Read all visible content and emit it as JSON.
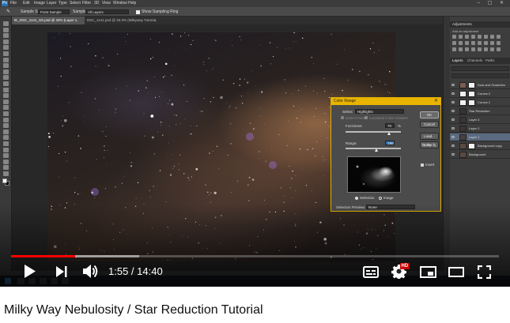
{
  "photoshop": {
    "logo": "Ps",
    "menu": [
      "File",
      "Edit",
      "Image",
      "Layer",
      "Type",
      "Select",
      "Filter",
      "3D",
      "View",
      "Window",
      "Help"
    ],
    "options": {
      "sample_size_label": "Sample Size:",
      "sample_size_value": "Point Sample",
      "sample_label": "Sample:",
      "sample_value": "All Layers",
      "show_ring_label": "Show Sampling Ring"
    },
    "tabs": [
      "IE_DSC_1141_SS.psd @ 33% (Layer 1, RGB/8) *",
      "DSC_1141.psd @ 33.3% (Milkyway Tutorial, RGB/8) *"
    ],
    "color_range": {
      "title": "Color Range",
      "select_label": "Select:",
      "select_value": "Highlights",
      "detect_faces": "Detect Faces",
      "localized_clusters": "Localized Color Clusters",
      "fuzziness_label": "Fuzziness:",
      "fuzziness_value": "70",
      "fuzziness_unit": "%",
      "range_label": "Range:",
      "range_value": "190",
      "view_selection": "Selection",
      "view_image": "Image",
      "preview_label": "Selection Preview:",
      "preview_value": "None",
      "buttons": [
        "OK",
        "Cancel",
        "Load...",
        "Save..."
      ],
      "invert_label": "Invert"
    },
    "adjustments": {
      "title": "Adjustments",
      "subtitle": "Add an adjustment"
    },
    "layers_tabs": [
      "Layers",
      "Channels",
      "Paths"
    ],
    "layers": [
      {
        "name": "Dust and Scratches",
        "mask": true,
        "selected": false,
        "thumb": "#7a5d50"
      },
      {
        "name": "Curves 2",
        "mask": true,
        "selected": false,
        "thumb": "#f2f2f2"
      },
      {
        "name": "Curves 1",
        "mask": true,
        "selected": false,
        "thumb": "#f2f2f2"
      },
      {
        "name": "Star Reduction",
        "mask": false,
        "selected": false,
        "thumb": "#3a3232"
      },
      {
        "name": "Layer 3",
        "mask": false,
        "selected": false,
        "thumb": "#3c3434"
      },
      {
        "name": "Layer 2",
        "mask": false,
        "selected": false,
        "thumb": "#3c3434"
      },
      {
        "name": "Layer 1",
        "mask": false,
        "selected": true,
        "thumb": "#4b4040"
      },
      {
        "name": "Background copy",
        "mask": true,
        "selected": false,
        "thumb": "#5a4a42"
      },
      {
        "name": "Background",
        "mask": false,
        "selected": false,
        "thumb": "#5a4a42"
      }
    ]
  },
  "player": {
    "current_time": "1:55",
    "separator": " / ",
    "duration": "14:40",
    "progress_played": 0.131,
    "progress_loaded": 0.262,
    "hd_badge": "HD",
    "colors": {
      "progress": "#ff0000",
      "hd": "#cc0000"
    }
  },
  "video": {
    "title": "Milky Way Nebulosity / Star Reduction Tutorial"
  }
}
